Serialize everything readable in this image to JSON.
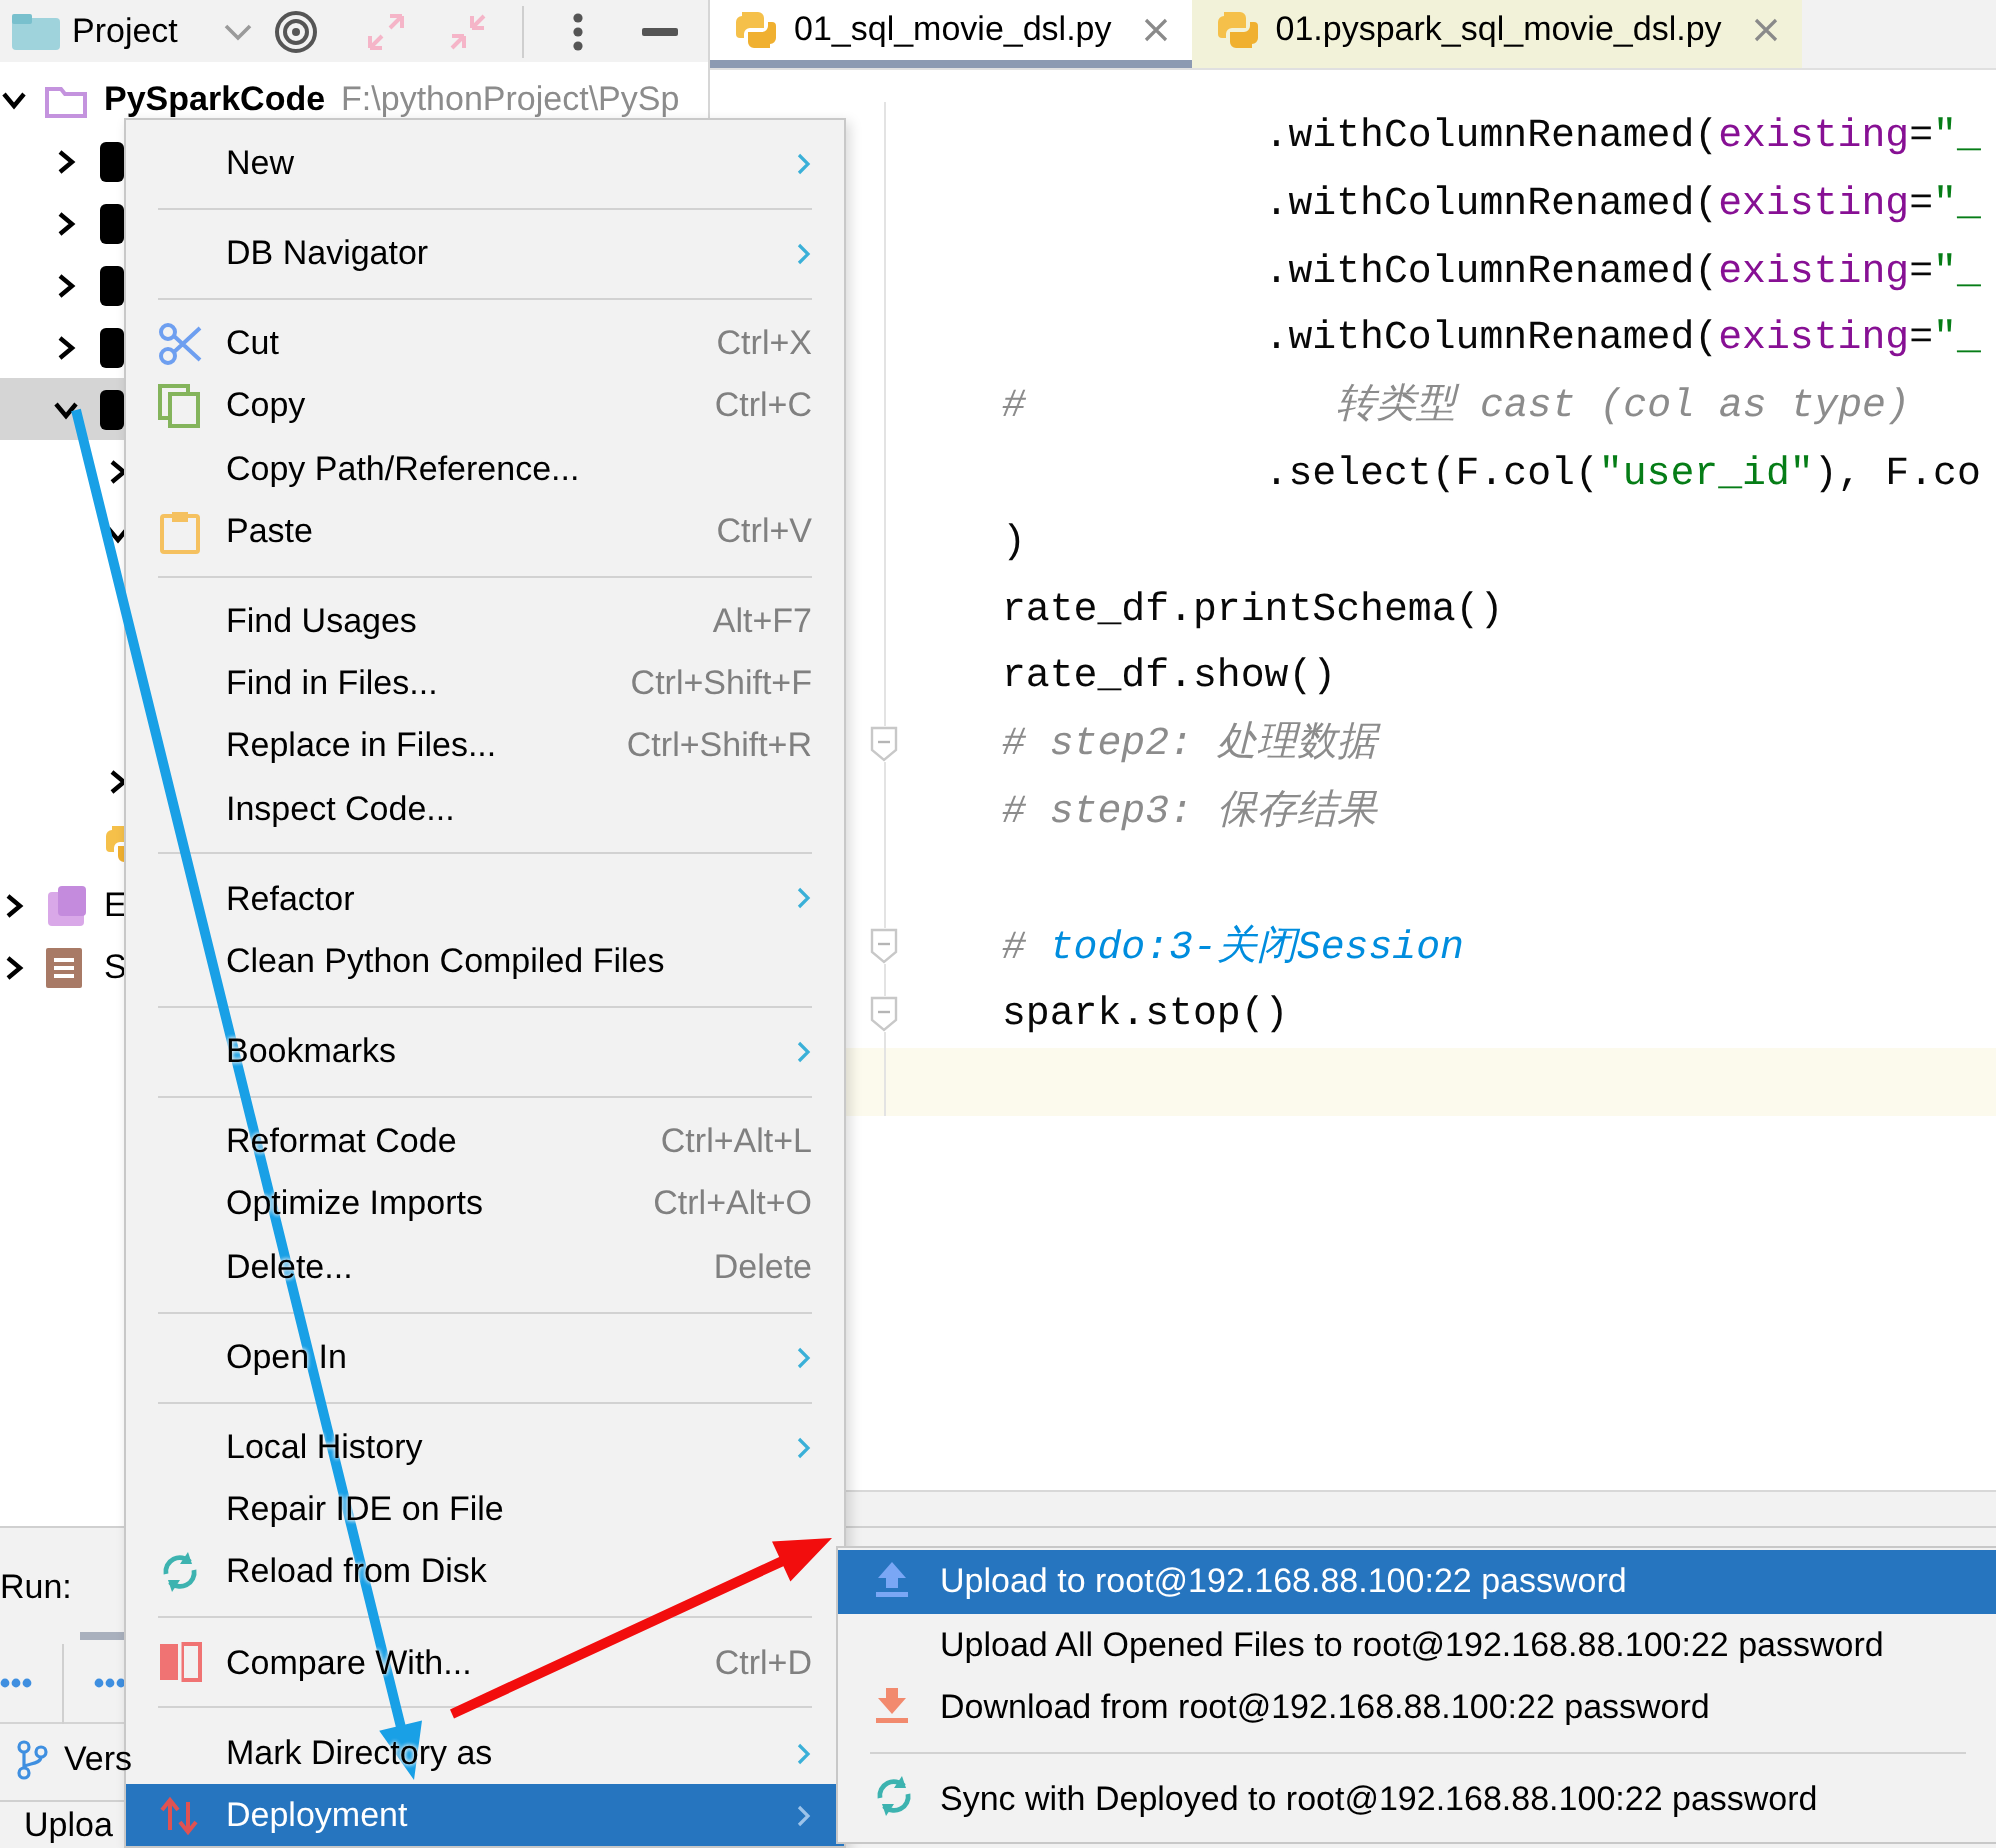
{
  "project_panel": {
    "title": "Project"
  },
  "tree": [
    {
      "label": "PySparkCode",
      "path": "F:\\pythonProject\\PySp",
      "kind": "project",
      "expanded": true,
      "selected": false,
      "children": [
        {
          "kind": "redacted",
          "expanded": false,
          "selected": false
        },
        {
          "kind": "redacted",
          "expanded": false,
          "selected": false
        },
        {
          "kind": "redacted",
          "expanded": false,
          "selected": false
        },
        {
          "kind": "redacted",
          "expanded": false,
          "selected": false
        },
        {
          "kind": "redacted",
          "expanded": true,
          "selected": true,
          "children": [
            {
              "kind": "folder",
              "expanded": false,
              "selected": false
            },
            {
              "kind": "folder",
              "expanded": true,
              "selected": false
            },
            {
              "kind": "folder",
              "expanded": false,
              "selected": false
            },
            {
              "kind": "python-file",
              "selected": false
            }
          ]
        }
      ]
    },
    {
      "label": "E",
      "kind": "library",
      "expanded": false,
      "selected": false
    },
    {
      "label": "S",
      "kind": "scratches",
      "expanded": false,
      "selected": false
    }
  ],
  "editor_tabs": [
    {
      "label": "01_sql_movie_dsl.py",
      "selected": true
    },
    {
      "label": "01.pyspark_sql_movie_dsl.py",
      "selected": false
    }
  ],
  "code_lines": [
    {
      "current": false,
      "fold": false,
      "tokens": [
        {
          "text": "           .withColumnRenamed(",
          "kind": "code"
        },
        {
          "text": "existing",
          "kind": "param"
        },
        {
          "text": "=",
          "kind": "code"
        },
        {
          "text": "\"_",
          "kind": "string"
        }
      ]
    },
    {
      "current": false,
      "fold": false,
      "tokens": [
        {
          "text": "           .withColumnRenamed(",
          "kind": "code"
        },
        {
          "text": "existing",
          "kind": "param"
        },
        {
          "text": "=",
          "kind": "code"
        },
        {
          "text": "\"_",
          "kind": "string"
        }
      ]
    },
    {
      "current": false,
      "fold": false,
      "tokens": [
        {
          "text": "           .withColumnRenamed(",
          "kind": "code"
        },
        {
          "text": "existing",
          "kind": "param"
        },
        {
          "text": "=",
          "kind": "code"
        },
        {
          "text": "\"_",
          "kind": "string"
        }
      ]
    },
    {
      "current": false,
      "fold": false,
      "tokens": [
        {
          "text": "           .withColumnRenamed(",
          "kind": "code"
        },
        {
          "text": "existing",
          "kind": "param"
        },
        {
          "text": "=",
          "kind": "code"
        },
        {
          "text": "\"_",
          "kind": "string"
        }
      ]
    },
    {
      "current": false,
      "fold": false,
      "tokens": [
        {
          "text": "#             转类型 cast (col as type)",
          "kind": "comment"
        }
      ]
    },
    {
      "current": false,
      "fold": false,
      "tokens": [
        {
          "text": "           .select(F.col(",
          "kind": "code"
        },
        {
          "text": "\"user_id\"",
          "kind": "string"
        },
        {
          "text": "), F.co",
          "kind": "code"
        }
      ]
    },
    {
      "current": false,
      "fold": false,
      "tokens": [
        {
          "text": ")",
          "kind": "code"
        }
      ]
    },
    {
      "current": false,
      "fold": false,
      "tokens": [
        {
          "text": "rate_df.printSchema()",
          "kind": "code"
        }
      ]
    },
    {
      "current": false,
      "fold": false,
      "tokens": [
        {
          "text": "rate_df.show()",
          "kind": "code"
        }
      ]
    },
    {
      "current": false,
      "fold": true,
      "tokens": [
        {
          "text": "# step2: 处理数据",
          "kind": "comment"
        }
      ]
    },
    {
      "current": false,
      "fold": false,
      "tokens": [
        {
          "text": "# step3: 保存结果",
          "kind": "comment"
        }
      ]
    },
    {
      "current": false,
      "fold": false
    },
    {
      "current": false,
      "fold": true,
      "tokens": [
        {
          "text": "# ",
          "kind": "comment"
        },
        {
          "text": "todo:3-关闭Session",
          "kind": "todo"
        }
      ]
    },
    {
      "current": false,
      "fold": true,
      "tokens": [
        {
          "text": "spark.stop()",
          "kind": "code"
        }
      ]
    },
    {
      "current": true,
      "fold": false
    }
  ],
  "run_panel": {
    "title": "Run:"
  },
  "tool_window_buttons": [
    {
      "label": "Vers"
    }
  ],
  "status_bar": {
    "text": "Uploa"
  },
  "context_menu": {
    "items": [
      {
        "kind": "item",
        "label": "New",
        "submenu": true,
        "selected": false
      },
      {
        "kind": "separator"
      },
      {
        "kind": "item",
        "label": "DB Navigator",
        "submenu": true,
        "selected": false
      },
      {
        "kind": "separator"
      },
      {
        "kind": "item",
        "label": "Cut",
        "shortcut": "Ctrl+X",
        "submenu": false,
        "selected": false
      },
      {
        "kind": "item",
        "label": "Copy",
        "shortcut": "Ctrl+C",
        "submenu": false,
        "selected": false
      },
      {
        "kind": "item",
        "label": "Copy Path/Reference...",
        "submenu": false,
        "selected": false
      },
      {
        "kind": "item",
        "label": "Paste",
        "shortcut": "Ctrl+V",
        "submenu": false,
        "selected": false
      },
      {
        "kind": "separator"
      },
      {
        "kind": "item",
        "label": "Find Usages",
        "shortcut": "Alt+F7",
        "submenu": false,
        "selected": false
      },
      {
        "kind": "item",
        "label": "Find in Files...",
        "shortcut": "Ctrl+Shift+F",
        "submenu": false,
        "selected": false
      },
      {
        "kind": "item",
        "label": "Replace in Files...",
        "shortcut": "Ctrl+Shift+R",
        "submenu": false,
        "selected": false
      },
      {
        "kind": "item",
        "label": "Inspect Code...",
        "submenu": false,
        "selected": false
      },
      {
        "kind": "separator"
      },
      {
        "kind": "item",
        "label": "Refactor",
        "submenu": true,
        "selected": false
      },
      {
        "kind": "item",
        "label": "Clean Python Compiled Files",
        "submenu": false,
        "selected": false
      },
      {
        "kind": "separator"
      },
      {
        "kind": "item",
        "label": "Bookmarks",
        "submenu": true,
        "selected": false
      },
      {
        "kind": "separator"
      },
      {
        "kind": "item",
        "label": "Reformat Code",
        "shortcut": "Ctrl+Alt+L",
        "submenu": false,
        "selected": false
      },
      {
        "kind": "item",
        "label": "Optimize Imports",
        "shortcut": "Ctrl+Alt+O",
        "submenu": false,
        "selected": false
      },
      {
        "kind": "item",
        "label": "Delete...",
        "shortcut": "Delete",
        "submenu": false,
        "selected": false
      },
      {
        "kind": "separator"
      },
      {
        "kind": "item",
        "label": "Open In",
        "submenu": true,
        "selected": false
      },
      {
        "kind": "separator"
      },
      {
        "kind": "item",
        "label": "Local History",
        "submenu": true,
        "selected": false
      },
      {
        "kind": "item",
        "label": "Repair IDE on File",
        "submenu": false,
        "selected": false
      },
      {
        "kind": "item",
        "label": "Reload from Disk",
        "submenu": false,
        "selected": false
      },
      {
        "kind": "separator"
      },
      {
        "kind": "item",
        "label": "Compare With...",
        "shortcut": "Ctrl+D",
        "submenu": false,
        "selected": false
      },
      {
        "kind": "separator"
      },
      {
        "kind": "item",
        "label": "Mark Directory as",
        "submenu": true,
        "selected": false
      },
      {
        "kind": "item",
        "label": "Deployment",
        "submenu": true,
        "selected": true
      }
    ]
  },
  "deployment_submenu": {
    "items": [
      {
        "kind": "item",
        "label": "Upload to root@192.168.88.100:22 password",
        "selected": true
      },
      {
        "kind": "item",
        "label": "Upload All Opened Files to root@192.168.88.100:22 password",
        "selected": false
      },
      {
        "kind": "item",
        "label": "Download from root@192.168.88.100:22 password",
        "selected": false
      },
      {
        "kind": "separator"
      },
      {
        "kind": "item",
        "label": "Sync with Deployed to root@192.168.88.100:22 password",
        "selected": false
      }
    ]
  }
}
